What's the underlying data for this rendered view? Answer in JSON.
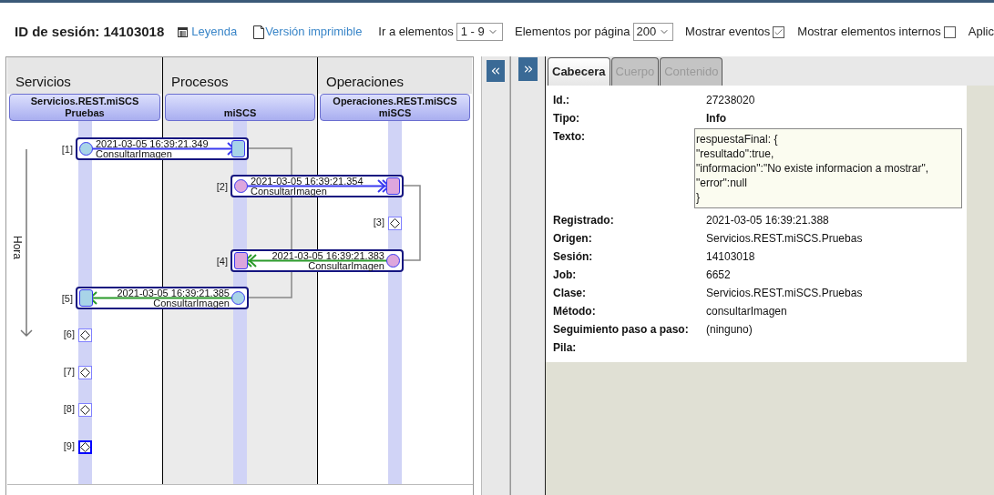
{
  "toolbar": {
    "session_label": "ID de sesión: 14103018",
    "links": [
      {
        "kind": "legend",
        "label": "Leyenda"
      },
      {
        "kind": "print",
        "label": "Versión imprimible"
      }
    ],
    "goto": {
      "label": "Ir a elementos",
      "value": "1 - 9"
    },
    "page_size": {
      "label": "Elementos por página",
      "value": "200"
    },
    "checkboxes": [
      {
        "label": "Mostrar eventos",
        "checked": true
      },
      {
        "label": "Mostrar elementos internos",
        "checked": false
      }
    ],
    "cut_label": "Aplic"
  },
  "diagram": {
    "axis_label": "Hora",
    "lanes": [
      {
        "group": "Servicios",
        "package": "Servicios.REST.miSCS",
        "name": "Pruebas"
      },
      {
        "group": "Procesos",
        "name": "miSCS"
      },
      {
        "group": "Operaciones",
        "package": "Operaciones.REST.miSCS",
        "name": "miSCS"
      }
    ],
    "items": [
      {
        "kind": "message",
        "index": "[1]",
        "time": "2021-03-05 16:39:21.349",
        "label": "ConsultarImagen",
        "return": false,
        "double_head": false,
        "color": "#a8d4e8"
      },
      {
        "kind": "message",
        "index": "[2]",
        "time": "2021-03-05 16:39:21.354",
        "label": "ConsultarImagen",
        "return": false,
        "double_head": true,
        "color": "#dda6dd"
      },
      {
        "kind": "event",
        "index": "[3]",
        "selected": false
      },
      {
        "kind": "message",
        "index": "[4]",
        "time": "2021-03-05 16:39:21.383",
        "label": "ConsultarImagen",
        "return": true,
        "double_head": true,
        "color": "#dda6dd"
      },
      {
        "kind": "message",
        "index": "[5]",
        "time": "2021-03-05 16:39:21.385",
        "label": "ConsultarImagen",
        "return": true,
        "double_head": false,
        "color": "#a8d4e8"
      },
      {
        "kind": "event",
        "index": "[6]",
        "selected": false
      },
      {
        "kind": "event",
        "index": "[7]",
        "selected": false
      },
      {
        "kind": "event",
        "index": "[8]",
        "selected": false
      },
      {
        "kind": "event",
        "index": "[9]",
        "selected": true
      }
    ]
  },
  "details": {
    "tabs": [
      {
        "label": "Cabecera",
        "selected": true
      },
      {
        "label": "Cuerpo",
        "selected": false
      },
      {
        "label": "Contenido",
        "selected": false
      }
    ],
    "fields": [
      {
        "kind": "text",
        "label": "Id.:",
        "value": "27238020"
      },
      {
        "kind": "bold",
        "label": "Tipo:",
        "value": "Info"
      },
      {
        "kind": "block",
        "label": "Texto:",
        "lines": [
          "respuestaFinal: {",
          "\"resultado\":true,",
          "\"informacion\":\"No existe informacion a mostrar\",",
          "\"error\":null",
          "}"
        ]
      },
      {
        "kind": "text",
        "label": "Registrado:",
        "value": "2021-03-05 16:39:21.388"
      },
      {
        "kind": "text",
        "label": "Origen:",
        "value": "Servicios.REST.miSCS.Pruebas"
      },
      {
        "kind": "text",
        "label": "Sesión:",
        "value": "14103018"
      },
      {
        "kind": "text",
        "label": "Job:",
        "value": "6652"
      },
      {
        "kind": "text",
        "label": "Clase:",
        "value": "Servicios.REST.miSCS.Pruebas"
      },
      {
        "kind": "text",
        "label": "Método:",
        "value": "consultarImagen"
      },
      {
        "kind": "text",
        "label": "Seguimiento paso a paso:",
        "value": "(ninguno)"
      },
      {
        "kind": "text",
        "label": "Pila:"
      }
    ]
  }
}
